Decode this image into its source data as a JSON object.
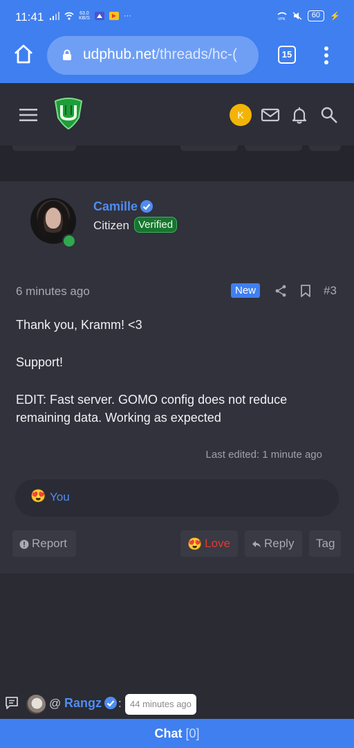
{
  "status_bar": {
    "time": "11:41",
    "net_speed_top": "63.0",
    "net_speed_bottom": "KB/S",
    "battery": "60",
    "icons": [
      "signal-icon",
      "wifi-icon",
      "vpn-icon",
      "mute-icon",
      "battery-icon"
    ]
  },
  "browser": {
    "url_host": "udphub.net",
    "url_path": "/threads/hc-(",
    "tab_count": "15"
  },
  "site_header": {
    "avatar_letter": "K",
    "icons": [
      "menu-icon",
      "mail-icon",
      "bell-icon",
      "search-icon"
    ]
  },
  "post": {
    "username": "Camille",
    "user_title": "Citizen",
    "badge": "Verified",
    "time": "6 minutes ago",
    "new_label": "New",
    "post_number": "#3",
    "body": [
      "Thank you, Kramm! <3",
      "Support!",
      "EDIT: Fast server. GOMO config does not reduce remaining data. Working as expected"
    ],
    "last_edited": "Last edited: 1 minute ago",
    "reaction_emoji": "😍",
    "reaction_by": "You",
    "actions": {
      "report": "Report",
      "love": "Love",
      "love_emoji": "😍",
      "reply": "Reply",
      "tag": "Tag"
    }
  },
  "chat": {
    "preview_user": "Rangz",
    "at": "@",
    "colon": ":",
    "preview_time": "44 minutes ago",
    "bar_label": "Chat",
    "bar_count": "[0]"
  },
  "colors": {
    "accent": "#3f7ff0",
    "link": "#4f8cf0",
    "love": "#e03b2f",
    "verified_green": "#17752f",
    "background": "#2a2b33"
  }
}
